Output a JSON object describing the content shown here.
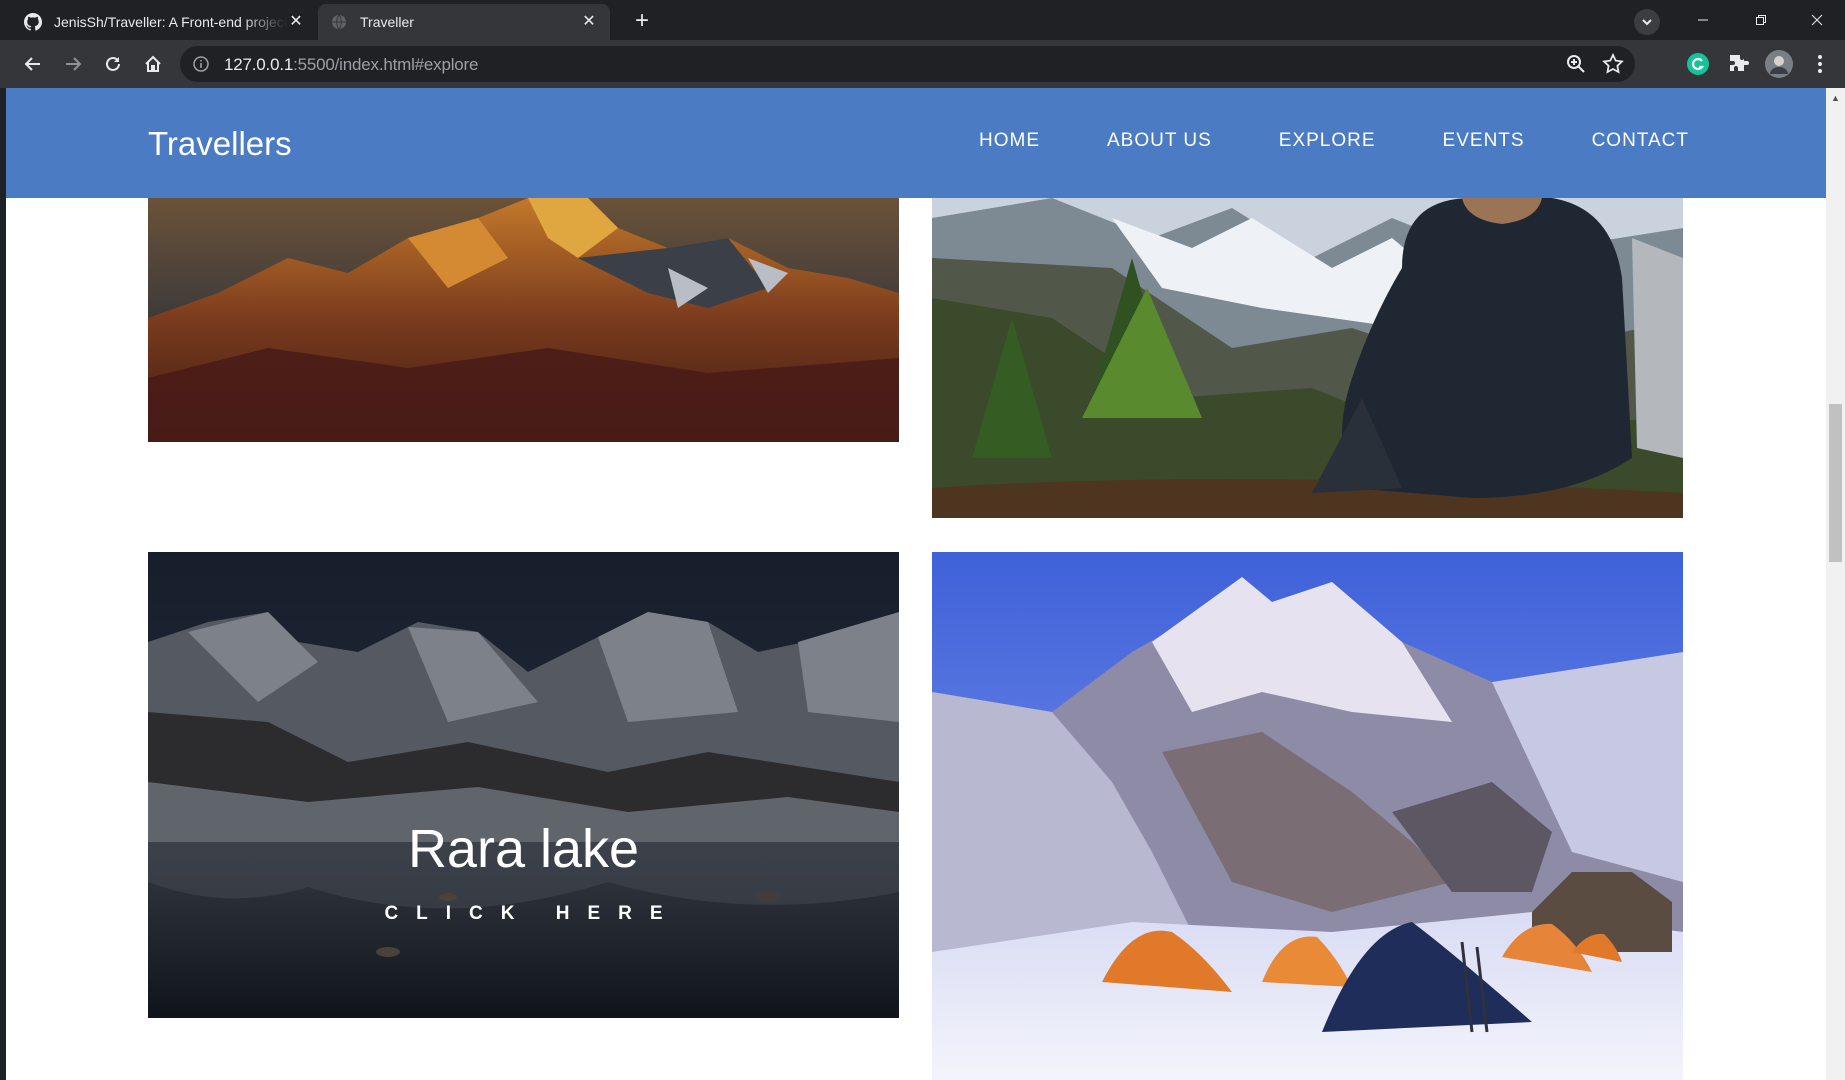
{
  "browser": {
    "tabs": [
      {
        "title": "JenisSh/Traveller: A Front-end project",
        "favicon": "github-icon",
        "active": false
      },
      {
        "title": "Traveller",
        "favicon": "globe-icon",
        "active": true
      }
    ],
    "url_host": "127.0.0.1",
    "url_rest": ":5500/index.html#explore",
    "colors": {
      "tabbar": "#202124",
      "toolbar": "#35363a"
    }
  },
  "site": {
    "brand": "Travellers",
    "nav": [
      "HOME",
      "ABOUT US",
      "EXPLORE",
      "EVENTS",
      "CONTACT"
    ],
    "nav_color": "#4a7bc3"
  },
  "gallery": {
    "items": [
      {
        "image": "sunset-mountain-peak"
      },
      {
        "image": "hiker-sitting-overlooking-snowy-valley"
      },
      {
        "image": "rara-lake-snowy-mountains",
        "caption": "Rara lake",
        "cta": "CLICK HERE",
        "hovered": true
      },
      {
        "image": "mountain-camp-orange-tents"
      }
    ]
  }
}
